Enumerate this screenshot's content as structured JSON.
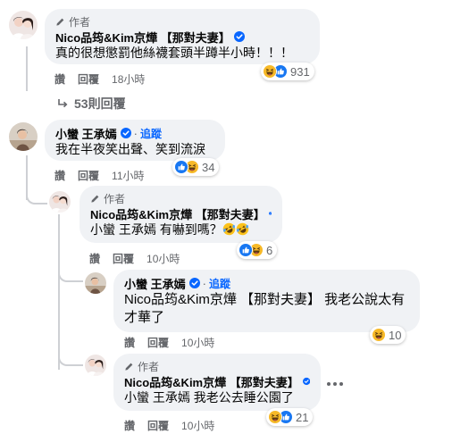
{
  "labels": {
    "author": "作者",
    "reply": "回覆",
    "like": "讚",
    "follow": "追蹤",
    "dot": "·"
  },
  "colors": {
    "bubble": "#f0f2f5",
    "secondary_text": "#65676b",
    "link_blue": "#0866ff",
    "thread_line": "#ced0d4"
  },
  "comments": [
    {
      "author_badge": true,
      "name": "Nico品筠&Kim京燁 【那對夫妻】",
      "verified": true,
      "text": "真的很想懲罰他絲襪套頭半蹲半小時！！！",
      "time": "18小時",
      "reactions": [
        "haha",
        "like"
      ],
      "reaction_count": "931",
      "replies_link": "53則回覆"
    },
    {
      "name": "小蠻 王承嫣",
      "verified": true,
      "follow": true,
      "text": "我在半夜笑出聲、笑到流淚",
      "time": "11小時",
      "reactions": [
        "like",
        "haha"
      ],
      "reaction_count": "34",
      "replies": [
        {
          "author_badge": true,
          "name": "Nico品筠&Kim京燁 【那對夫妻】",
          "verified": true,
          "text": "小蠻 王承嫣 有嚇到嗎？",
          "emoji": [
            "rofl",
            "rofl"
          ],
          "time": "10小時",
          "reactions": [
            "like",
            "haha"
          ],
          "reaction_count": "6"
        },
        {
          "name": "小蠻 王承嫣",
          "verified": true,
          "follow": true,
          "text": "Nico品筠&Kim京燁 【那對夫妻】 我老公說太有才華了",
          "time": "10小時",
          "reactions": [
            "haha"
          ],
          "reaction_count": "10"
        },
        {
          "author_badge": true,
          "name": "Nico品筠&Kim京燁 【那對夫妻】",
          "verified": true,
          "text": "小蠻 王承嫣 我老公去睡公園了",
          "time": "10小時",
          "reactions": [
            "haha",
            "like"
          ],
          "reaction_count": "21",
          "more_icon": "more-options-icon"
        }
      ]
    }
  ]
}
